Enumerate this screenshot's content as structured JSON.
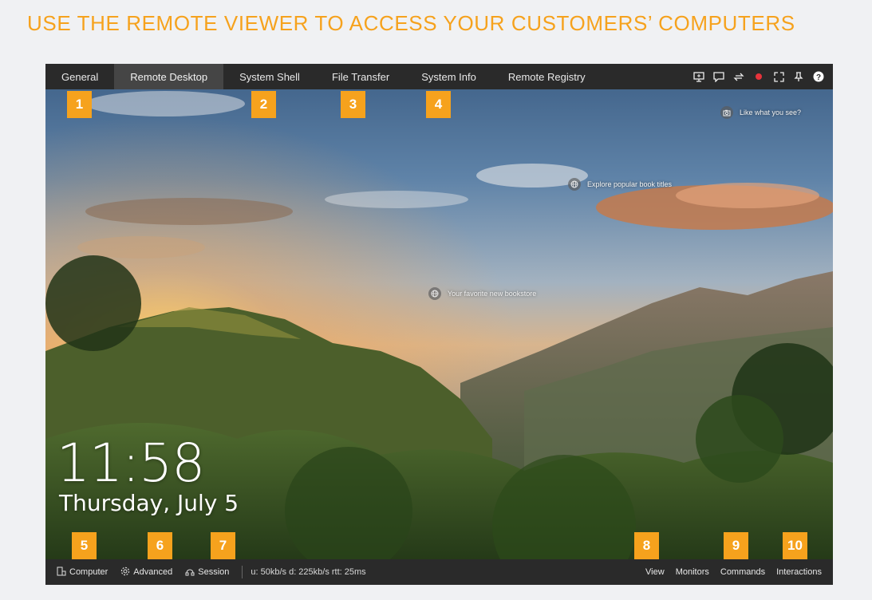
{
  "heading": "USE THE REMOTE VIEWER TO ACCESS YOUR CUSTOMERS’ COMPUTERS",
  "colors": {
    "accent": "#f6a21d",
    "bar": "#2a2a2a",
    "active_tab": "#454545"
  },
  "tabs": [
    {
      "label": "General",
      "active": false
    },
    {
      "label": "Remote Desktop",
      "active": true
    },
    {
      "label": "System Shell",
      "active": false
    },
    {
      "label": "File Transfer",
      "active": false
    },
    {
      "label": "System Info",
      "active": false
    },
    {
      "label": "Remote Registry",
      "active": false
    }
  ],
  "toolbar_icons": [
    "monitor-icon",
    "chat-icon",
    "swap-arrows-icon",
    "record-icon",
    "fullscreen-icon",
    "pin-icon",
    "help-icon"
  ],
  "badges": [
    "1",
    "2",
    "3",
    "4",
    "5",
    "6",
    "7",
    "8",
    "9",
    "10"
  ],
  "desktop": {
    "hotspots": [
      {
        "icon": "camera-icon",
        "label": "Like what you see?"
      },
      {
        "icon": "globe-icon",
        "label": "Explore popular book titles"
      },
      {
        "icon": "globe-icon",
        "label": "Your favorite new bookstore"
      }
    ],
    "clock": {
      "time": "11:58",
      "date": "Thursday, July 5"
    }
  },
  "bottom_bar": {
    "left": [
      {
        "icon": "computer-icon",
        "label": "Computer"
      },
      {
        "icon": "gear-icon",
        "label": "Advanced"
      },
      {
        "icon": "session-icon",
        "label": "Session"
      }
    ],
    "stats": "u: 50kb/s d: 225kb/s rtt: 25ms",
    "right": [
      "View",
      "Monitors",
      "Commands",
      "Interactions"
    ]
  }
}
